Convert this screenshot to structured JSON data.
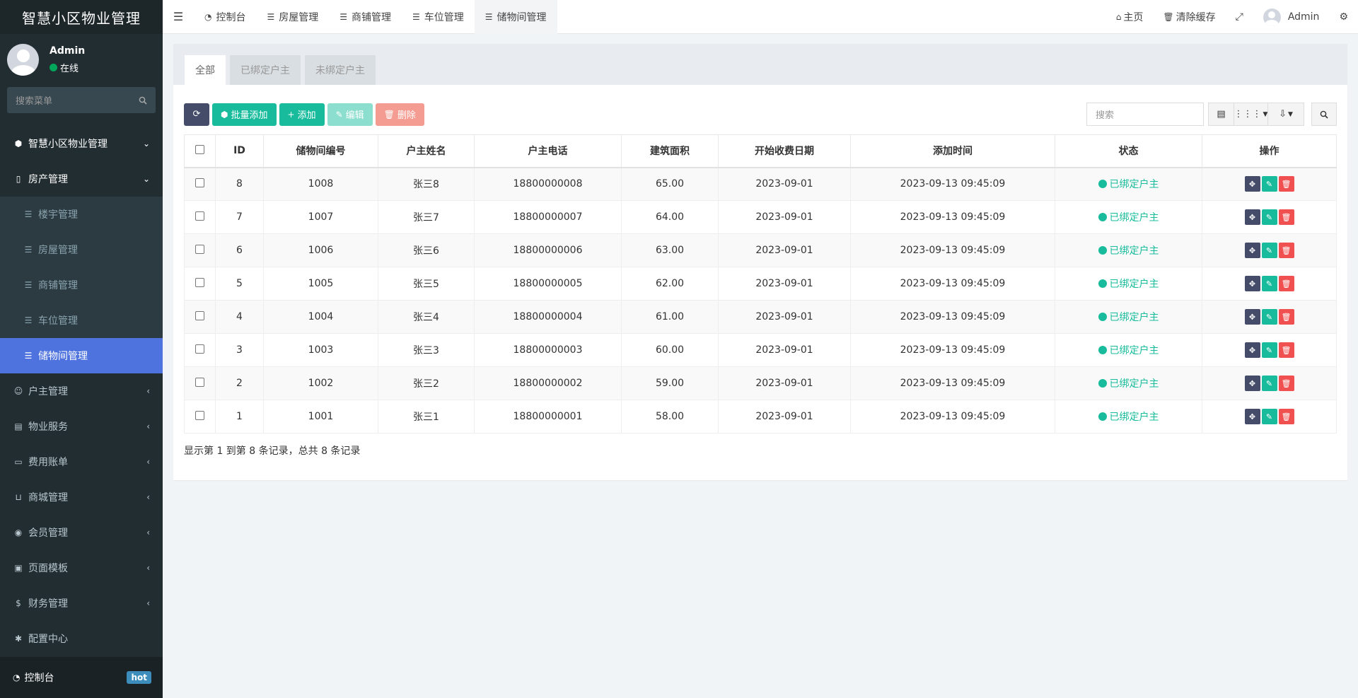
{
  "sidebar": {
    "brand": "智慧小区物业管理",
    "user": {
      "name": "Admin",
      "status": "在线"
    },
    "search_placeholder": "搜索菜单",
    "top_menu": {
      "label": "智慧小区物业管理",
      "icon": "cubes-icon"
    },
    "property_menu": {
      "label": "房产管理",
      "items": [
        {
          "label": "楼宇管理"
        },
        {
          "label": "房屋管理"
        },
        {
          "label": "商铺管理"
        },
        {
          "label": "车位管理"
        },
        {
          "label": "储物间管理"
        }
      ]
    },
    "menus": [
      {
        "label": "户主管理",
        "icon": "user-icon"
      },
      {
        "label": "物业服务",
        "icon": "server-icon"
      },
      {
        "label": "费用账单",
        "icon": "bill-icon"
      },
      {
        "label": "商城管理",
        "icon": "basket-icon"
      },
      {
        "label": "会员管理",
        "icon": "user-circle-icon"
      },
      {
        "label": "页面模板",
        "icon": "image-icon"
      },
      {
        "label": "财务管理",
        "icon": "dollar-icon"
      },
      {
        "label": "配置中心",
        "icon": "gear-icon"
      }
    ],
    "bottom": {
      "label": "控制台",
      "badge": "hot"
    }
  },
  "navbar": {
    "tabs": [
      {
        "label": "控制台"
      },
      {
        "label": "房屋管理"
      },
      {
        "label": "商铺管理"
      },
      {
        "label": "车位管理"
      },
      {
        "label": "储物间管理"
      }
    ],
    "home": "主页",
    "clear_cache": "清除缓存",
    "user": "Admin"
  },
  "panel": {
    "tabs": [
      "全部",
      "已绑定户主",
      "未绑定户主"
    ],
    "buttons": {
      "batch_add": "批量添加",
      "add": "添加",
      "edit": "编辑",
      "delete": "删除"
    },
    "search_placeholder": "搜索"
  },
  "table": {
    "columns": [
      "ID",
      "储物间编号",
      "户主姓名",
      "户主电话",
      "建筑面积",
      "开始收费日期",
      "添加时间",
      "状态",
      "操作"
    ],
    "rows": [
      {
        "id": "8",
        "code": "1008",
        "owner": "张三8",
        "phone": "18800000008",
        "area": "65.00",
        "start": "2023-09-01",
        "added": "2023-09-13 09:45:09",
        "status": "已绑定户主"
      },
      {
        "id": "7",
        "code": "1007",
        "owner": "张三7",
        "phone": "18800000007",
        "area": "64.00",
        "start": "2023-09-01",
        "added": "2023-09-13 09:45:09",
        "status": "已绑定户主"
      },
      {
        "id": "6",
        "code": "1006",
        "owner": "张三6",
        "phone": "18800000006",
        "area": "63.00",
        "start": "2023-09-01",
        "added": "2023-09-13 09:45:09",
        "status": "已绑定户主"
      },
      {
        "id": "5",
        "code": "1005",
        "owner": "张三5",
        "phone": "18800000005",
        "area": "62.00",
        "start": "2023-09-01",
        "added": "2023-09-13 09:45:09",
        "status": "已绑定户主"
      },
      {
        "id": "4",
        "code": "1004",
        "owner": "张三4",
        "phone": "18800000004",
        "area": "61.00",
        "start": "2023-09-01",
        "added": "2023-09-13 09:45:09",
        "status": "已绑定户主"
      },
      {
        "id": "3",
        "code": "1003",
        "owner": "张三3",
        "phone": "18800000003",
        "area": "60.00",
        "start": "2023-09-01",
        "added": "2023-09-13 09:45:09",
        "status": "已绑定户主"
      },
      {
        "id": "2",
        "code": "1002",
        "owner": "张三2",
        "phone": "18800000002",
        "area": "59.00",
        "start": "2023-09-01",
        "added": "2023-09-13 09:45:09",
        "status": "已绑定户主"
      },
      {
        "id": "1",
        "code": "1001",
        "owner": "张三1",
        "phone": "18800000001",
        "area": "58.00",
        "start": "2023-09-01",
        "added": "2023-09-13 09:45:09",
        "status": "已绑定户主"
      }
    ],
    "pagination_info": "显示第 1 到第 8 条记录，总共 8 条记录"
  },
  "colors": {
    "sidebar_bg": "#222d32",
    "active_menu": "#4e73df",
    "accent_green": "#18bc9c",
    "danger": "#f05050",
    "dark_button": "#444c69"
  }
}
